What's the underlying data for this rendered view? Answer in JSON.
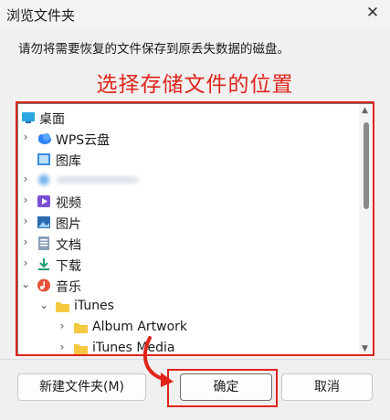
{
  "window": {
    "title": "浏览文件夹",
    "close_label": "✕"
  },
  "description": "请勿将需要恢复的文件保存到原丢失数据的磁盘。",
  "annotation": "选择存储文件的位置",
  "tree": {
    "items": [
      {
        "label": "桌面",
        "chevron": "",
        "icon": "desktop-icon"
      },
      {
        "label": "WPS云盘",
        "chevron": "›",
        "icon": "cloud-icon"
      },
      {
        "label": "图库",
        "chevron": "",
        "icon": "gallery-icon"
      },
      {
        "label": "",
        "chevron": "›",
        "icon": "blurred-item-icon"
      },
      {
        "label": "视频",
        "chevron": "›",
        "icon": "video-icon"
      },
      {
        "label": "图片",
        "chevron": "›",
        "icon": "pictures-icon"
      },
      {
        "label": "文档",
        "chevron": "›",
        "icon": "documents-icon"
      },
      {
        "label": "下载",
        "chevron": "›",
        "icon": "download-icon"
      },
      {
        "label": "音乐",
        "chevron": "⌄",
        "icon": "music-icon"
      },
      {
        "label": "iTunes",
        "chevron": "⌄",
        "icon": "folder-icon"
      },
      {
        "label": "Album Artwork",
        "chevron": "›",
        "icon": "folder-icon"
      },
      {
        "label": "iTunes Media",
        "chevron": "›",
        "icon": "folder-icon"
      }
    ]
  },
  "buttons": {
    "new_folder": "新建文件夹(M)",
    "ok": "确定",
    "cancel": "取消"
  },
  "colors": {
    "annotation_red": "#e0241a",
    "folder_yellow": "#f5c842"
  }
}
